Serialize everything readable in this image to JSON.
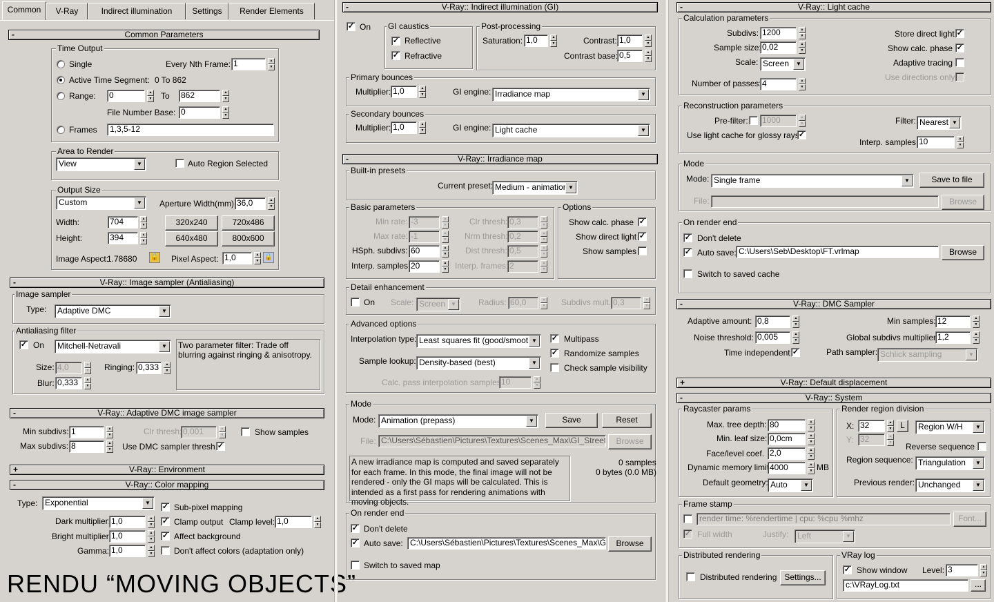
{
  "tabs": [
    "Common",
    "V-Ray",
    "Indirect illumination",
    "Settings",
    "Render Elements"
  ],
  "common": {
    "title": "Common Parameters",
    "time_output": "Time Output",
    "single": "Single",
    "every_nth": "Every Nth Frame:",
    "every_nth_val": "1",
    "active_segment": "Active Time Segment:",
    "active_range": "0 To 862",
    "range": "Range:",
    "range_from": "0",
    "to": "To",
    "range_to": "862",
    "file_number_base": "File Number Base:",
    "fnb_val": "0",
    "frames": "Frames",
    "frames_val": "1,3,5-12",
    "area_to_render": "Area to Render",
    "area_val": "View",
    "auto_region": "Auto Region Selected",
    "output_size": "Output Size",
    "output_val": "Custom",
    "aperture": "Aperture Width(mm):",
    "aperture_val": "36,0",
    "width": "Width:",
    "width_val": "704",
    "height": "Height:",
    "height_val": "394",
    "p1": "320x240",
    "p2": "720x486",
    "p3": "640x480",
    "p4": "800x600",
    "image_aspect": "Image Aspect:",
    "image_aspect_val": "1.78680",
    "pixel_aspect": "Pixel Aspect:",
    "pixel_aspect_val": "1,0"
  },
  "image_sampler": {
    "title": "V-Ray:: Image sampler (Antialiasing)",
    "group": "Image sampler",
    "type": "Type:",
    "type_val": "Adaptive DMC",
    "aa_filter": "Antialiasing filter",
    "on": "On",
    "filter_val": "Mitchell-Netravali",
    "desc": "Two parameter filter: Trade off blurring against ringing & anisotropy.",
    "size": "Size:",
    "size_val": "4,0",
    "ringing": "Ringing:",
    "ringing_val": "0,333",
    "blur": "Blur:",
    "blur_val": "0,333"
  },
  "adaptive_dmc": {
    "title": "V-Ray:: Adaptive DMC image sampler",
    "min": "Min subdivs:",
    "min_val": "1",
    "clr": "Clr thresh:",
    "clr_val": "0,001",
    "show_samples": "Show samples",
    "max": "Max subdivs:",
    "max_val": "8",
    "use_dmc": "Use DMC sampler thresh."
  },
  "environment": {
    "title": "V-Ray:: Environment"
  },
  "color_mapping": {
    "title": "V-Ray:: Color mapping",
    "type": "Type:",
    "type_val": "Exponential",
    "subpixel": "Sub-pixel mapping",
    "dark": "Dark multiplier:",
    "dark_val": "1,0",
    "clamp_output": "Clamp output",
    "clamp_level": "Clamp level:",
    "clamp_level_val": "1,0",
    "bright": "Bright multiplier:",
    "bright_val": "1,0",
    "affect_bg": "Affect background",
    "gamma": "Gamma:",
    "gamma_val": "1,0",
    "dont_affect": "Don't affect colors (adaptation only)"
  },
  "caption": "RENDU “MOVING OBJECTS”",
  "gi": {
    "title": "V-Ray:: Indirect illumination (GI)",
    "on": "On",
    "gi_caustics": "GI caustics",
    "reflective": "Reflective",
    "refractive": "Refractive",
    "post": "Post-processing",
    "saturation": "Saturation:",
    "saturation_val": "1,0",
    "contrast": "Contrast:",
    "contrast_val": "1,0",
    "contrast_base": "Contrast base:",
    "contrast_base_val": "0,5",
    "primary": "Primary bounces",
    "multiplier": "Multiplier:",
    "p_mult": "1,0",
    "gi_engine": "GI engine:",
    "p_engine": "Irradiance map",
    "secondary": "Secondary bounces",
    "s_mult": "1,0",
    "s_engine": "Light cache"
  },
  "irr": {
    "title": "V-Ray:: Irradiance map",
    "presets": "Built-in presets",
    "current_preset": "Current preset:",
    "preset_val": "Medium - animation",
    "basic": "Basic parameters",
    "min_rate": "Min rate:",
    "min_rate_val": "-3",
    "max_rate": "Max rate:",
    "max_rate_val": "-1",
    "hsph": "HSph. subdivs:",
    "hsph_val": "60",
    "interp": "Interp. samples:",
    "interp_val": "20",
    "clr_thresh": "Clr thresh:",
    "clr_thresh_val": "0,3",
    "nrm_thresh": "Nrm thresh:",
    "nrm_thresh_val": "0,2",
    "dist_thresh": "Dist thresh:",
    "dist_thresh_val": "0,5",
    "interp_frames": "Interp. frames:",
    "interp_frames_val": "2",
    "options": "Options",
    "show_calc": "Show calc. phase",
    "show_direct": "Show direct light",
    "show_samples": "Show samples",
    "detail": "Detail enhancement",
    "on": "On",
    "scale": "Scale:",
    "scale_val": "Screen",
    "radius": "Radius:",
    "radius_val": "60,0",
    "subdivs_mult": "Subdivs mult.",
    "subdivs_mult_val": "0,3",
    "advanced": "Advanced options",
    "interp_type": "Interpolation type:",
    "interp_type_val": "Least squares fit (good/smooth",
    "multipass": "Multipass",
    "sample_lookup": "Sample lookup:",
    "lookup_val": "Density-based (best)",
    "randomize": "Randomize samples",
    "check_vis": "Check sample visibility",
    "calc_pass": "Calc. pass interpolation samples:",
    "calc_pass_val": "10",
    "mode_group": "Mode",
    "mode": "Mode:",
    "mode_val": "Animation (prepass)",
    "save": "Save",
    "reset": "Reset",
    "file": "File:",
    "file_val": "C:\\Users\\Sébastien\\Pictures\\Textures\\Scenes_Max\\GI_Street",
    "browse": "Browse",
    "desc": "A new irradiance map is computed and saved separately for each frame. In this mode, the final image will not be rendered - only the GI maps will be calculated. This is intended as a first pass for rendering animations with moving objects.",
    "samples": "0 samples",
    "bytes": "0 bytes (0.0 MB)",
    "on_render_end": "On render end",
    "dont_delete": "Don't delete",
    "auto_save": "Auto save:",
    "auto_save_val": "C:\\Users\\Sébastien\\Pictures\\Textures\\Scenes_Max\\G",
    "switch": "Switch to saved map"
  },
  "lc": {
    "title": "V-Ray:: Light cache",
    "calc": "Calculation parameters",
    "subdivs": "Subdivs:",
    "subdivs_val": "1200",
    "sample_size": "Sample size:",
    "sample_size_val": "0,02",
    "scale": "Scale:",
    "scale_val": "Screen",
    "passes": "Number of passes:",
    "passes_val": "4",
    "store_direct": "Store direct light",
    "show_calc": "Show calc. phase",
    "adaptive": "Adaptive tracing",
    "use_dirs": "Use directions only",
    "recon": "Reconstruction parameters",
    "prefilter": "Pre-filter:",
    "prefilter_val": "1000",
    "filter": "Filter:",
    "filter_val": "Nearest",
    "glossy": "Use light cache for glossy rays",
    "interp": "Interp. samples:",
    "interp_val": "10",
    "mode_group": "Mode",
    "mode": "Mode:",
    "mode_val": "Single frame",
    "save_to_file": "Save to file",
    "file": "File:",
    "browse": "Browse",
    "on_render_end": "On render end",
    "dont_delete": "Don't delete",
    "auto_save": "Auto save:",
    "auto_save_val": "C:\\Users\\Seb\\Desktop\\FT.vrlmap",
    "switch": "Switch to saved cache"
  },
  "dmc": {
    "title": "V-Ray:: DMC Sampler",
    "adaptive_amount": "Adaptive amount:",
    "adaptive_amount_val": "0,8",
    "min_samples": "Min samples:",
    "min_samples_val": "12",
    "noise": "Noise threshold:",
    "noise_val": "0,005",
    "global": "Global subdivs multiplier:",
    "global_val": "1,2",
    "time_indep": "Time independent",
    "path_sampler": "Path sampler:",
    "path_val": "Schlick sampling"
  },
  "displacement": {
    "title": "V-Ray:: Default displacement"
  },
  "system": {
    "title": "V-Ray:: System",
    "raycaster": "Raycaster params",
    "max_tree": "Max. tree depth:",
    "max_tree_val": "80",
    "min_leaf": "Min. leaf size:",
    "min_leaf_val": "0,0cm",
    "face_coef": "Face/level coef.",
    "face_coef_val": "2,0",
    "dyn_mem": "Dynamic memory limit:",
    "dyn_mem_val": "4000",
    "mb": "MB",
    "default_geom": "Default geometry:",
    "geom_val": "Auto",
    "render_region": "Render region division",
    "x": "X:",
    "x_val": "32",
    "y": "Y:",
    "y_val": "32",
    "l": "L",
    "region_val": "Region W/H",
    "reverse": "Reverse sequence",
    "region_seq": "Region sequence:",
    "region_seq_val": "Triangulation",
    "prev_render": "Previous render:",
    "prev_render_val": "Unchanged",
    "frame_stamp": "Frame stamp",
    "stamp_val": "render time: %rendertime | cpu: %cpu %mhz",
    "font": "Font...",
    "full_width": "Full width",
    "justify": "Justify:",
    "justify_val": "Left",
    "dist": "Distributed rendering",
    "dist_label": "Distributed rendering",
    "settings": "Settings...",
    "vray_log": "VRay log",
    "show_window": "Show window",
    "level": "Level:",
    "level_val": "3",
    "log_path": "c:\\VRayLog.txt",
    "dots": "..."
  }
}
